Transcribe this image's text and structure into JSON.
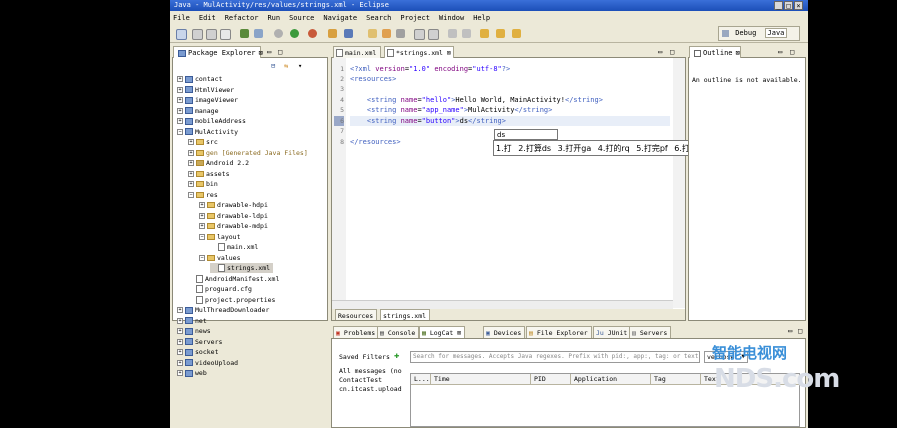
{
  "window": {
    "title": "Java - MulActivity/res/values/strings.xml - Eclipse",
    "controls": [
      "_",
      "□",
      "×"
    ]
  },
  "menu": [
    "File",
    "Edit",
    "Refactor",
    "Run",
    "Source",
    "Navigate",
    "Search",
    "Project",
    "Window",
    "Help"
  ],
  "perspectives": {
    "debug": "Debug",
    "java": "Java"
  },
  "package_explorer": {
    "title": "Package Explorer",
    "items": [
      {
        "label": "contact",
        "kind": "project",
        "depth": 0,
        "expanded": false
      },
      {
        "label": "HtmlViewer",
        "kind": "project",
        "depth": 0,
        "expanded": false
      },
      {
        "label": "imageViewer",
        "kind": "project",
        "depth": 0,
        "expanded": false
      },
      {
        "label": "manage",
        "kind": "project",
        "depth": 0,
        "expanded": false
      },
      {
        "label": "mobileAddress",
        "kind": "project",
        "depth": 0,
        "expanded": false
      },
      {
        "label": "MulActivity",
        "kind": "project",
        "depth": 0,
        "expanded": true
      },
      {
        "label": "src",
        "kind": "folder",
        "depth": 1,
        "expanded": false
      },
      {
        "label": "gen [Generated Java Files]",
        "kind": "folder",
        "depth": 1,
        "expanded": false
      },
      {
        "label": "Android 2.2",
        "kind": "lib",
        "depth": 1,
        "expanded": false
      },
      {
        "label": "assets",
        "kind": "folder",
        "depth": 1,
        "expanded": false
      },
      {
        "label": "bin",
        "kind": "folder",
        "depth": 1,
        "expanded": false
      },
      {
        "label": "res",
        "kind": "folder",
        "depth": 1,
        "expanded": true
      },
      {
        "label": "drawable-hdpi",
        "kind": "folder",
        "depth": 2,
        "expanded": false
      },
      {
        "label": "drawable-ldpi",
        "kind": "folder",
        "depth": 2,
        "expanded": false
      },
      {
        "label": "drawable-mdpi",
        "kind": "folder",
        "depth": 2,
        "expanded": false
      },
      {
        "label": "layout",
        "kind": "folder",
        "depth": 2,
        "expanded": true
      },
      {
        "label": "main.xml",
        "kind": "file",
        "depth": 3,
        "expanded": null
      },
      {
        "label": "values",
        "kind": "folder",
        "depth": 2,
        "expanded": true
      },
      {
        "label": "strings.xml",
        "kind": "file",
        "depth": 3,
        "expanded": null,
        "selected": true
      },
      {
        "label": "AndroidManifest.xml",
        "kind": "file",
        "depth": 1,
        "expanded": null
      },
      {
        "label": "proguard.cfg",
        "kind": "file",
        "depth": 1,
        "expanded": null
      },
      {
        "label": "project.properties",
        "kind": "file",
        "depth": 1,
        "expanded": null
      },
      {
        "label": "MulThreadDownloader",
        "kind": "project",
        "depth": 0,
        "expanded": false
      },
      {
        "label": "net",
        "kind": "project",
        "depth": 0,
        "expanded": false
      },
      {
        "label": "news",
        "kind": "project",
        "depth": 0,
        "expanded": false
      },
      {
        "label": "Servers",
        "kind": "project",
        "depth": 0,
        "expanded": false
      },
      {
        "label": "socket",
        "kind": "project",
        "depth": 0,
        "expanded": false
      },
      {
        "label": "videoUpload",
        "kind": "project",
        "depth": 0,
        "expanded": false
      },
      {
        "label": "web",
        "kind": "project",
        "depth": 0,
        "expanded": false
      }
    ]
  },
  "editor": {
    "tabs": [
      {
        "label": "main.xml",
        "active": false
      },
      {
        "label": "*strings.xml",
        "active": true
      }
    ],
    "line_numbers": [
      "1",
      "2",
      "3",
      "4",
      "5",
      "6",
      "7",
      "8"
    ],
    "bottom_tabs": [
      {
        "label": "Resources",
        "active": false
      },
      {
        "label": "strings.xml",
        "active": true
      }
    ]
  },
  "ime": {
    "composition": "ds",
    "candidates": [
      "1.打",
      "2.打算ds",
      "3.打开ga",
      "4.打的rq",
      "5.打完pf",
      "6.打印qg"
    ],
    "next_arrow": "▸"
  },
  "outline": {
    "title": "Outline",
    "message": "An outline is not available."
  },
  "bottom": {
    "tabs": [
      "Problems",
      "Console",
      "LogCat",
      "Devices",
      "File Explorer",
      "JUnit",
      "Servers"
    ],
    "active_tab": "LogCat",
    "saved_filters_label": "Saved Filters",
    "filters": [
      "All messages (no",
      "ContactTest",
      "cn.itcast.upload"
    ],
    "search_placeholder": "Search for messages. Accepts Java regexes. Prefix with pid:, app:, tag: or text:",
    "level": "verbose",
    "columns": [
      "L...",
      "Time",
      "PID",
      "Application",
      "Tag",
      "Text"
    ]
  },
  "watermark": {
    "brand": "智能电视网",
    "site": "NDS.com",
    "brand_color": "#3a8fd8"
  }
}
